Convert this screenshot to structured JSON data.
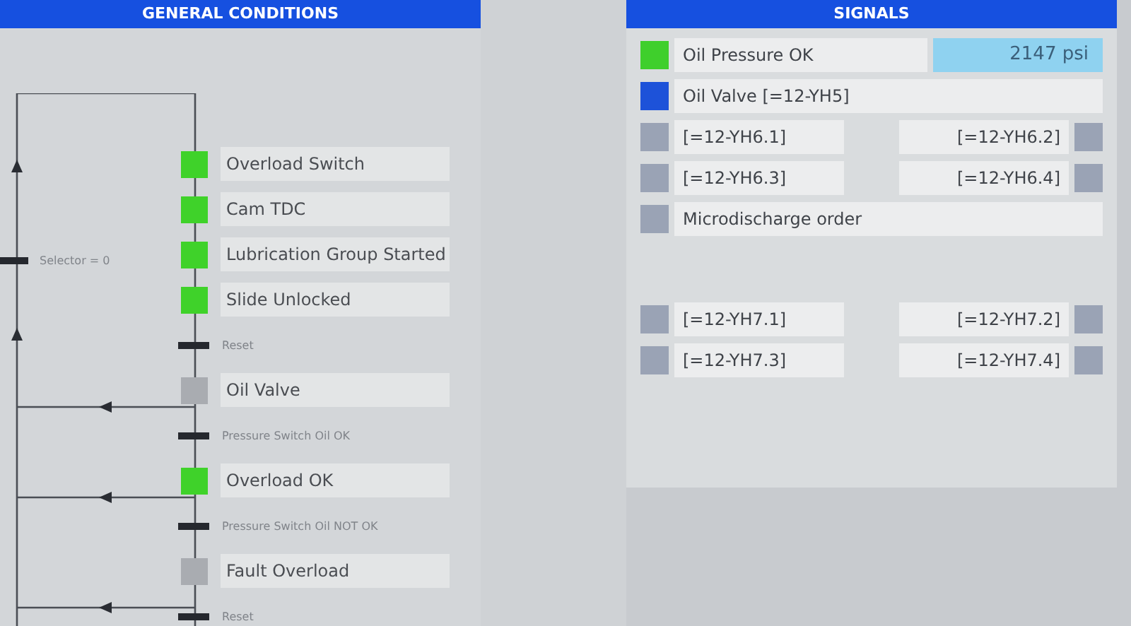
{
  "general_conditions": {
    "title": "GENERAL CONDITIONS",
    "side_transition": {
      "label": "Selector = 0"
    },
    "steps": [
      {
        "kind": "condition",
        "label": "Overload Switch",
        "on": true
      },
      {
        "kind": "condition",
        "label": "Cam TDC",
        "on": true
      },
      {
        "kind": "condition",
        "label": "Lubrication Group Started",
        "on": true
      },
      {
        "kind": "condition",
        "label": "Slide Unlocked",
        "on": true
      },
      {
        "kind": "transition",
        "label": "Reset"
      },
      {
        "kind": "condition",
        "label": "Oil Valve",
        "on": false
      },
      {
        "kind": "transition",
        "label": "Pressure Switch Oil OK"
      },
      {
        "kind": "condition",
        "label": "Overload OK",
        "on": true
      },
      {
        "kind": "transition",
        "label": "Pressure Switch Oil NOT OK"
      },
      {
        "kind": "condition",
        "label": "Fault Overload",
        "on": false
      },
      {
        "kind": "transition",
        "label": "Reset"
      }
    ]
  },
  "signals": {
    "title": "SIGNALS",
    "groups": [
      {
        "rows": [
          {
            "kind": "single",
            "label": "Oil Pressure OK",
            "color": "#3fcf2c",
            "value": "2147 psi"
          },
          {
            "kind": "single",
            "label": "Oil Valve [=12-YH5]",
            "color": "#1d52d9"
          },
          {
            "kind": "pair",
            "left": {
              "label": "[=12-YH6.1]",
              "color": "#9aa3b5"
            },
            "right": {
              "label": "[=12-YH6.2]",
              "color": "#9aa3b5"
            }
          },
          {
            "kind": "pair",
            "left": {
              "label": "[=12-YH6.3]",
              "color": "#9aa3b5"
            },
            "right": {
              "label": "[=12-YH6.4]",
              "color": "#9aa3b5"
            }
          },
          {
            "kind": "single",
            "label": "Microdischarge order",
            "color": "#9aa3b5"
          }
        ]
      },
      {
        "rows": [
          {
            "kind": "pair",
            "left": {
              "label": "[=12-YH7.1]",
              "color": "#9aa3b5"
            },
            "right": {
              "label": "[=12-YH7.2]",
              "color": "#9aa3b5"
            }
          },
          {
            "kind": "pair",
            "left": {
              "label": "[=12-YH7.3]",
              "color": "#9aa3b5"
            },
            "right": {
              "label": "[=12-YH7.4]",
              "color": "#9aa3b5"
            }
          }
        ]
      }
    ]
  }
}
